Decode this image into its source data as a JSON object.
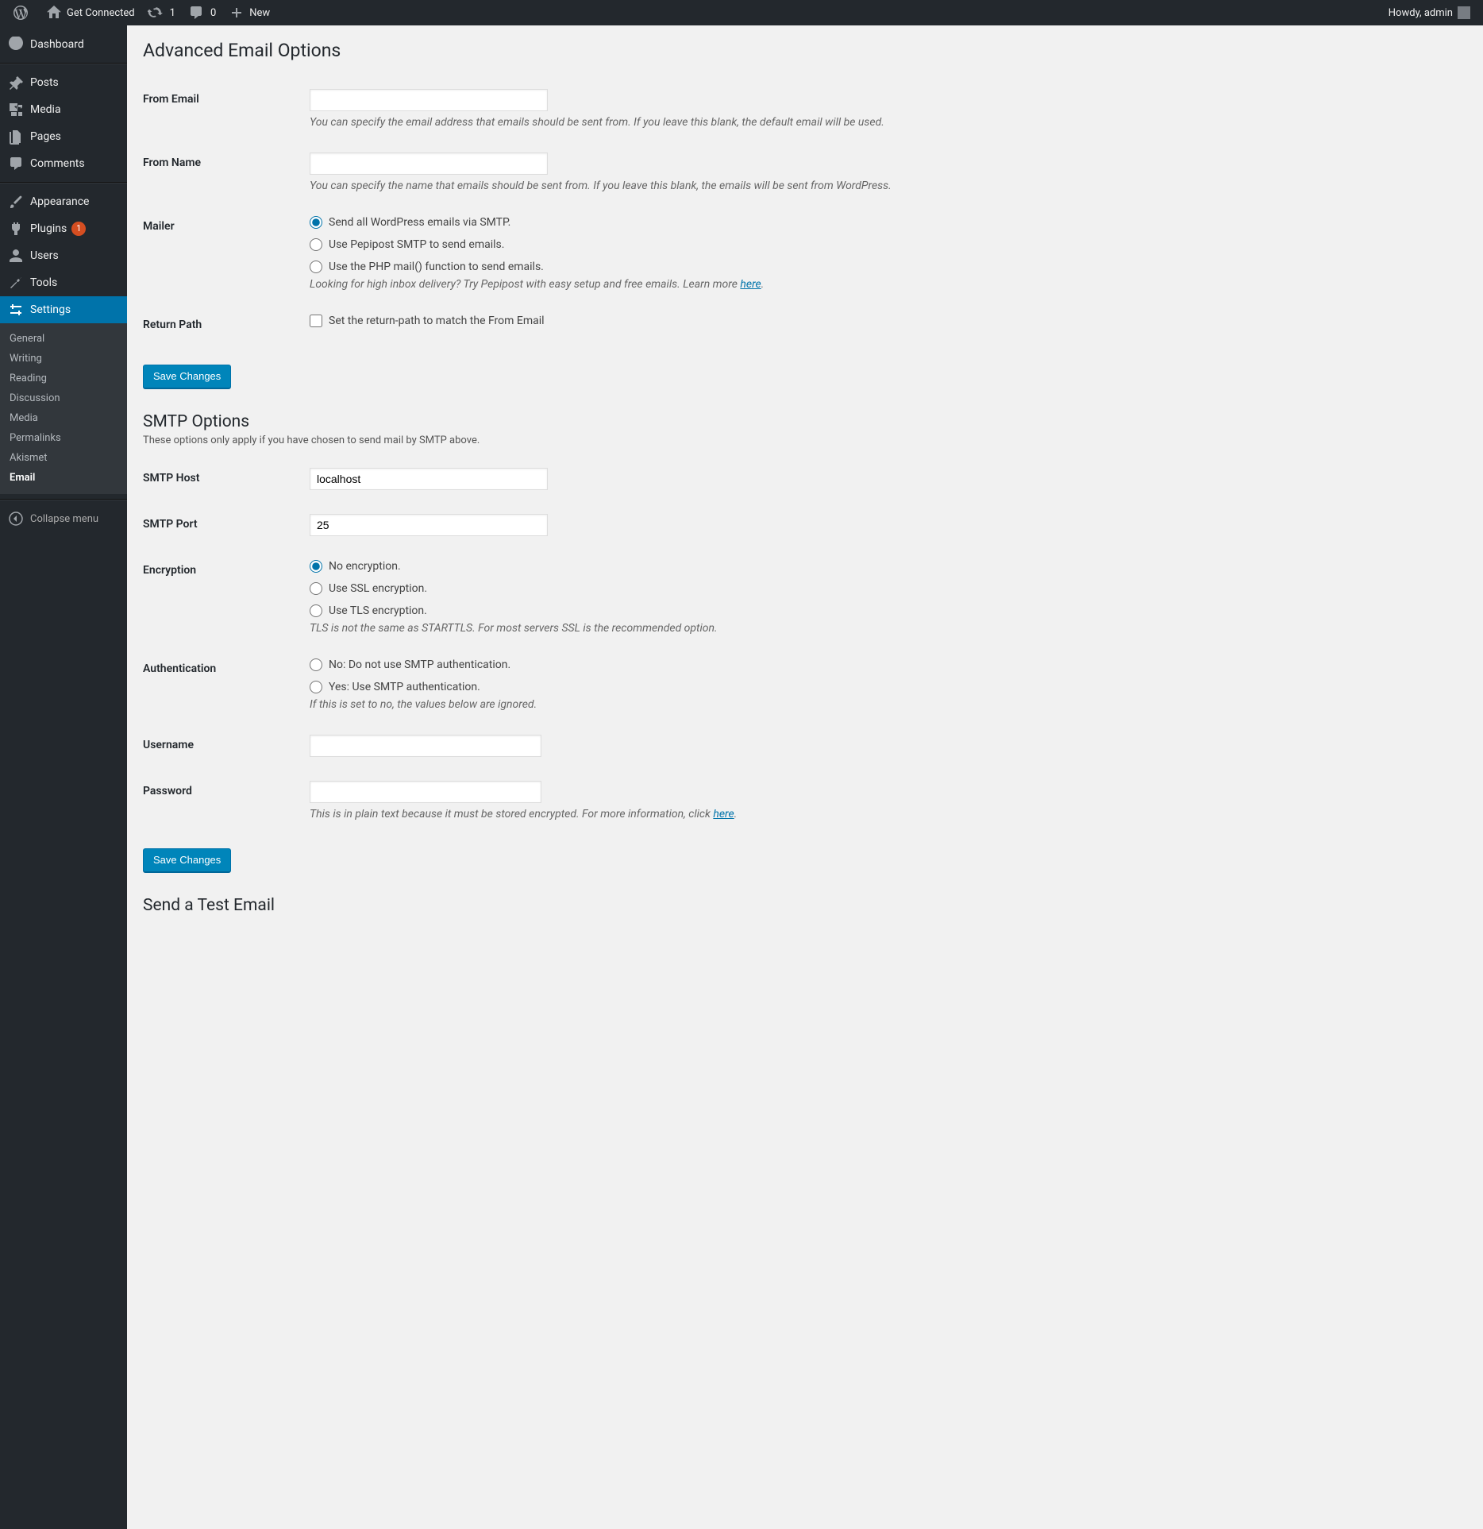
{
  "adminbar": {
    "site_name": "Get Connected",
    "updates_count": "1",
    "comments_count": "0",
    "new_label": "New",
    "howdy_prefix": "Howdy,",
    "user_name": "admin"
  },
  "sidebar": {
    "items": [
      {
        "label": "Dashboard",
        "icon": "dashboard"
      },
      {
        "label": "Posts",
        "icon": "pin"
      },
      {
        "label": "Media",
        "icon": "media"
      },
      {
        "label": "Pages",
        "icon": "page"
      },
      {
        "label": "Comments",
        "icon": "comment"
      },
      {
        "label": "Appearance",
        "icon": "brush"
      },
      {
        "label": "Plugins",
        "icon": "plug",
        "badge": "1"
      },
      {
        "label": "Users",
        "icon": "user"
      },
      {
        "label": "Tools",
        "icon": "wrench"
      },
      {
        "label": "Settings",
        "icon": "sliders"
      }
    ],
    "submenu": [
      "General",
      "Writing",
      "Reading",
      "Discussion",
      "Media",
      "Permalinks",
      "Akismet",
      "Email"
    ],
    "submenu_current": "Email",
    "collapse_label": "Collapse menu"
  },
  "page": {
    "title": "Advanced Email Options",
    "from_email": {
      "label": "From Email",
      "value": "",
      "desc": "You can specify the email address that emails should be sent from. If you leave this blank, the default email will be used."
    },
    "from_name": {
      "label": "From Name",
      "value": "",
      "desc": "You can specify the name that emails should be sent from. If you leave this blank, the emails will be sent from WordPress."
    },
    "mailer": {
      "label": "Mailer",
      "opt1": "Send all WordPress emails via SMTP.",
      "opt2": "Use Pepipost SMTP to send emails.",
      "opt3": "Use the PHP mail() function to send emails.",
      "desc_pre": "Looking for high inbox delivery? Try Pepipost with easy setup and free emails. Learn more ",
      "desc_link": "here"
    },
    "return_path": {
      "label": "Return Path",
      "opt": "Set the return-path to match the From Email"
    },
    "save_label": "Save Changes",
    "smtp_heading": "SMTP Options",
    "smtp_sub": "These options only apply if you have chosen to send mail by SMTP above.",
    "smtp_host": {
      "label": "SMTP Host",
      "value": "localhost"
    },
    "smtp_port": {
      "label": "SMTP Port",
      "value": "25"
    },
    "encryption": {
      "label": "Encryption",
      "opt1": "No encryption.",
      "opt2": "Use SSL encryption.",
      "opt3": "Use TLS encryption.",
      "desc": "TLS is not the same as STARTTLS. For most servers SSL is the recommended option."
    },
    "auth": {
      "label": "Authentication",
      "opt1": "No: Do not use SMTP authentication.",
      "opt2": "Yes: Use SMTP authentication.",
      "desc": "If this is set to no, the values below are ignored."
    },
    "username": {
      "label": "Username",
      "value": ""
    },
    "password": {
      "label": "Password",
      "value": "",
      "desc_pre": "This is in plain text because it must be stored encrypted. For more information, click ",
      "desc_link": "here"
    },
    "test_heading": "Send a Test Email"
  }
}
